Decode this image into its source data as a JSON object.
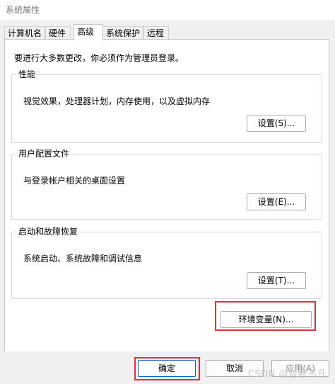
{
  "window": {
    "title": "系统属性"
  },
  "tabs": [
    {
      "label": "计算机名",
      "active": false
    },
    {
      "label": "硬件",
      "active": false
    },
    {
      "label": "高级",
      "active": true
    },
    {
      "label": "系统保护",
      "active": false
    },
    {
      "label": "远程",
      "active": false
    }
  ],
  "admin_note": "要进行大多数更改，你必须作为管理员登录。",
  "groups": {
    "performance": {
      "title": "性能",
      "description": "视觉效果，处理器计划，内存使用，以及虚拟内存",
      "button": "设置(S)..."
    },
    "user_profiles": {
      "title": "用户配置文件",
      "description": "与登录帐户相关的桌面设置",
      "button": "设置(E)..."
    },
    "startup_recovery": {
      "title": "启动和故障恢复",
      "description": "系统启动、系统故障和调试信息",
      "button": "设置(T)..."
    }
  },
  "env_button": "环境变量(N)...",
  "dialog_buttons": {
    "ok": "确定",
    "cancel": "取消",
    "apply": "应用(A)"
  },
  "watermark": "CSDN @智者不凡"
}
